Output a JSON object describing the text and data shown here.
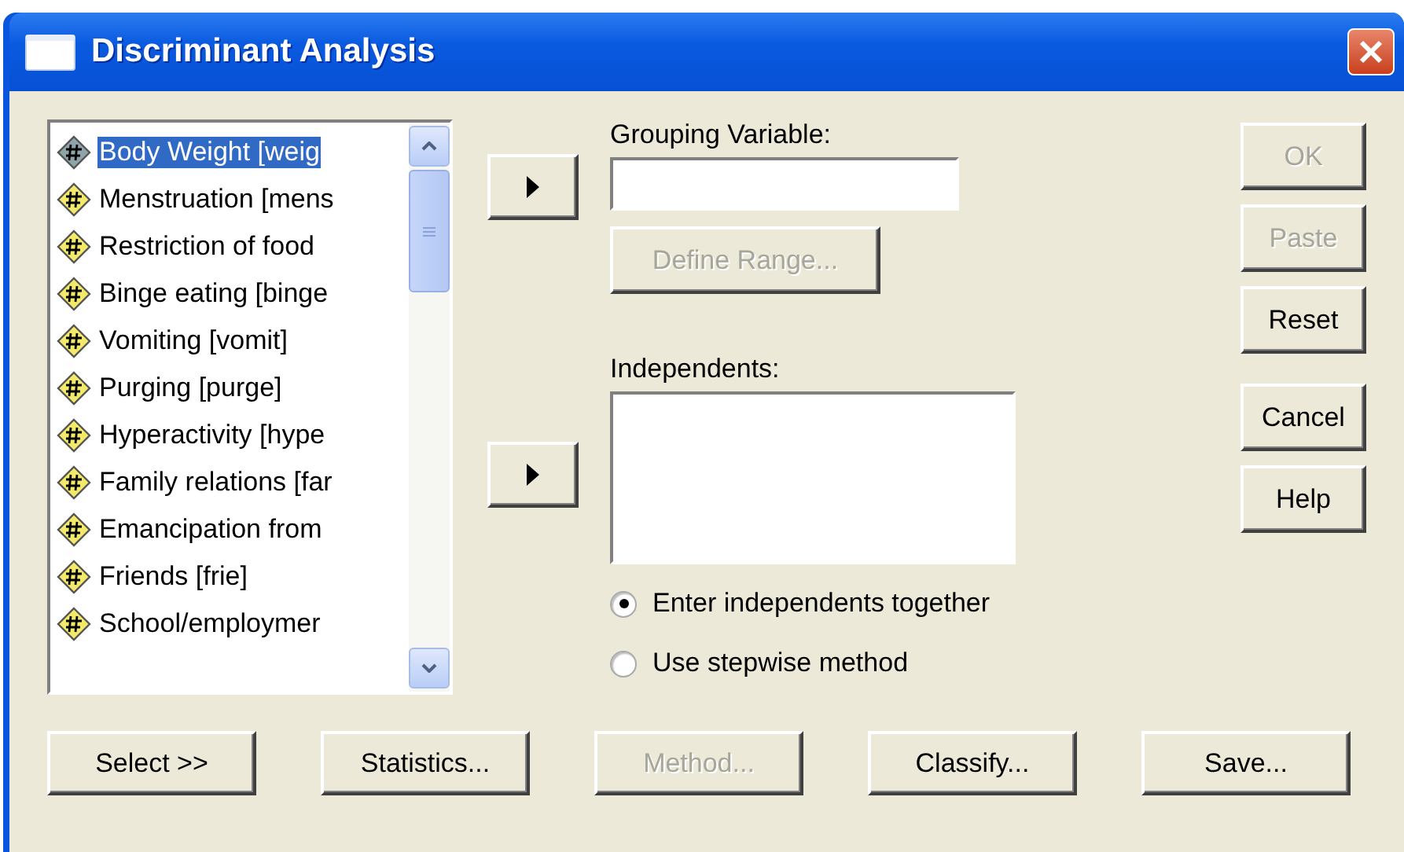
{
  "window": {
    "title": "Discriminant Analysis"
  },
  "variables": [
    {
      "label": "Body Weight [weig",
      "selected": true
    },
    {
      "label": "Menstruation [mens",
      "selected": false
    },
    {
      "label": "Restriction of food",
      "selected": false
    },
    {
      "label": "Binge eating [binge",
      "selected": false
    },
    {
      "label": "Vomiting [vomit]",
      "selected": false
    },
    {
      "label": "Purging [purge]",
      "selected": false
    },
    {
      "label": "Hyperactivity [hype",
      "selected": false
    },
    {
      "label": "Family relations [far",
      "selected": false
    },
    {
      "label": "Emancipation from",
      "selected": false
    },
    {
      "label": "Friends [frie]",
      "selected": false
    },
    {
      "label": "School/employmer",
      "selected": false
    }
  ],
  "grouping_variable": {
    "label": "Grouping Variable:",
    "define_range": {
      "label": "Define Range...",
      "disabled": true
    }
  },
  "independents": {
    "label": "Independents:"
  },
  "methods": [
    {
      "label": "Enter independents together",
      "selected": true
    },
    {
      "label": "Use stepwise method",
      "selected": false
    }
  ],
  "side_buttons": [
    {
      "label": "OK",
      "disabled": true
    },
    {
      "label": "Paste",
      "disabled": true
    },
    {
      "label": "Reset",
      "disabled": false
    },
    {
      "label": "Cancel",
      "disabled": false
    },
    {
      "label": "Help",
      "disabled": false
    }
  ],
  "bottom_buttons": [
    {
      "label": "Select >>",
      "disabled": false
    },
    {
      "label": "Statistics...",
      "disabled": false
    },
    {
      "label": "Method...",
      "disabled": true
    },
    {
      "label": "Classify...",
      "disabled": false
    },
    {
      "label": "Save...",
      "disabled": false
    }
  ]
}
